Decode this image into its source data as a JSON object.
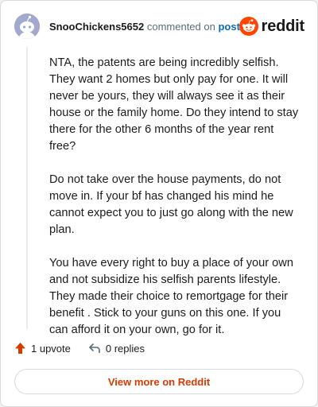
{
  "comment": {
    "username": "SnooChickens5652",
    "commented_text": "commented on",
    "post_link": "post",
    "avatar_icon": "snoo-avatar-icon",
    "paragraphs": [
      "NTA, the patents are being incredibly selfish. They want 2 homes but only pay for one. It will never be yours, they will always see it as their house or the family home. Do they intend to stay there for the other 6 months of the year rent free?",
      "Do not take over the house payments, do not move in. If your bf has changed his mind he cannot expect you to just go along with the new plan.",
      "You have every right to buy a place of your own and not subsidize his selfish parents lifestyle. They made their choice to remortgage for their benefit . Stick to your guns on this one. If you can afford it on your own, go for it."
    ]
  },
  "brand": {
    "wordmark": "reddit",
    "icon": "reddit-logo-icon",
    "color": "#ff4500"
  },
  "actions": {
    "upvote_label": "1 upvote",
    "upvote_icon": "upvote-arrow-icon",
    "reply_label": "0 replies",
    "reply_icon": "reply-arrow-icon"
  },
  "footer": {
    "view_more_label": "View more on Reddit",
    "accent_color": "#d93a00"
  }
}
